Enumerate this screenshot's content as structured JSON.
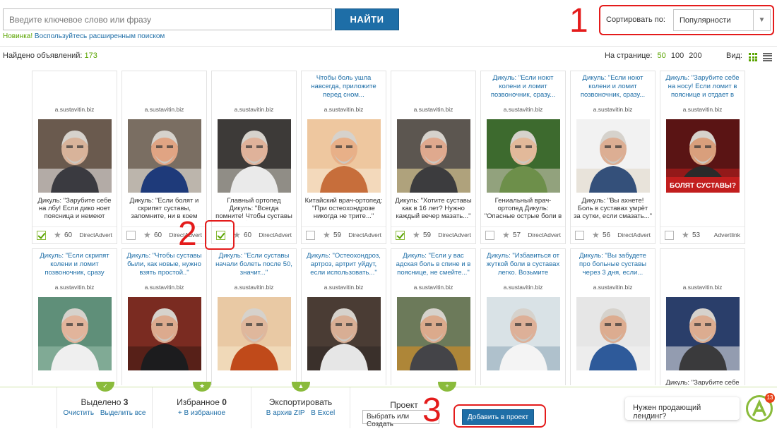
{
  "search": {
    "placeholder": "Введите ключевое слово или фразу",
    "button": "НАЙТИ",
    "hint_new": "Новинка!",
    "hint_link": "Воспользуйтесь расширенным поиском"
  },
  "sort": {
    "label": "Сортировать по:",
    "value": "Популярности"
  },
  "annotations": [
    "1",
    "2",
    "3"
  ],
  "results": {
    "found_label": "Найдено объявлений:",
    "found_count": "173",
    "per_page_label": "На странице:",
    "per_page_options": [
      "50",
      "100",
      "200"
    ],
    "per_page_active": "50",
    "view_label": "Вид:"
  },
  "cards": [
    {
      "title": "",
      "domain": "a.sustavitin.biz",
      "desc": "Дикуль: \"Зарубите себе на лбу! Если дико ноет поясница и немеют ноги...\"",
      "checked": true,
      "score": "60",
      "network": "DirectAdvert",
      "photo": "bearded-man-garlic"
    },
    {
      "title": "",
      "domain": "a.sustavitin.biz",
      "desc": "Дикуль: \"Если болят и скрипят суставы, запомните, ни в коем случае...\"",
      "checked": false,
      "score": "60",
      "network": "DirectAdvert",
      "photo": "strongman-lifting"
    },
    {
      "title": "",
      "domain": "a.sustavitin.biz",
      "desc": "Главный ортопед Дикуль: \"Всегда помните! Чтобы суставы не болели...\"",
      "checked": true,
      "score": "60",
      "network": "DirectAdvert",
      "photo": "man-at-table"
    },
    {
      "title": "Чтобы боль ушла навсегда, приложите перед сном...",
      "domain": "a.sustavitin.biz",
      "desc": "Китайский врач-ортопед: \"При остеохондрозе никогда не трите...\"",
      "checked": false,
      "score": "59",
      "network": "DirectAdvert",
      "photo": "neck-bagel"
    },
    {
      "title": "",
      "domain": "a.sustavitin.biz",
      "desc": "Дикуль: \"Хотите суставы как в 16 лет? Нужно каждый вечер мазать...\"",
      "checked": true,
      "score": "59",
      "network": "DirectAdvert",
      "photo": "man-with-soda"
    },
    {
      "title": "Дикуль: \"Если ноют колени и ломит позвоночник, сразу...",
      "domain": "a.sustavitin.biz",
      "desc": "Гениальный врач-ортопед Дикуль: \"Опасные острые боли в суставах полностью...\"",
      "checked": false,
      "score": "57",
      "network": "DirectAdvert",
      "photo": "woman-yoga"
    },
    {
      "title": "Дикуль: \"Если ноют колени и ломит позвоночник, сразу...",
      "domain": "a.sustavitin.biz",
      "desc": "Дикуль: \"Вы ахнете! Боль в суставах умрёт за сутки, если смазать...\"",
      "checked": false,
      "score": "56",
      "network": "DirectAdvert",
      "photo": "man-with-soda-2"
    },
    {
      "title": "Дикуль: \"Зарубите себе на носу! Если ломит в пояснице и отдает в",
      "domain": "a.sustavitin.biz",
      "desc": "",
      "checked": false,
      "score": "53",
      "network": "Advertlink",
      "photo": "strongman-banner",
      "photo_text": "БОЛЯТ СУСТАВЫ?"
    },
    {
      "title": "Дикуль: \"Если скрипят колени и ломит позвоночник, сразу",
      "domain": "a.sustavitin.biz",
      "desc": "",
      "checked": false,
      "score": "",
      "network": "",
      "photo": "man-white-coat"
    },
    {
      "title": "Дикуль: \"Чтобы суставы были, как новые, нужно взять простой..\"",
      "domain": "a.sustavitin.biz",
      "desc": "",
      "checked": false,
      "score": "",
      "network": "",
      "photo": "man-dark-suit"
    },
    {
      "title": "Дикуль: \"Если суставы начали болеть после 50, значит...\"",
      "domain": "a.sustavitin.biz",
      "desc": "",
      "checked": false,
      "score": "",
      "network": "",
      "photo": "man-spine"
    },
    {
      "title": "Дикуль: \"Остеохондроз, артроз, артрит уйдут, если использовать...\"",
      "domain": "a.sustavitin.biz",
      "desc": "",
      "checked": false,
      "score": "",
      "network": "",
      "photo": "man-thinking"
    },
    {
      "title": "Дикуль: \"Если у вас адская боль в спине и в пояснице, не смейте...\"",
      "domain": "a.sustavitin.biz",
      "desc": "",
      "checked": false,
      "score": "",
      "network": "",
      "photo": "man-microphone"
    },
    {
      "title": "Дикуль: \"Избавиться от жуткой боли в суставах легко. Возьмите",
      "domain": "a.sustavitin.biz",
      "desc": "",
      "checked": false,
      "score": "",
      "network": "",
      "photo": "man-lab-coat"
    },
    {
      "title": "Дикуль: \"Вы забудете про больные суставы через 3 дня, если...",
      "domain": "a.sustavitin.biz",
      "desc": "",
      "checked": false,
      "score": "",
      "network": "",
      "photo": "man-blue-scrubs"
    },
    {
      "title": "",
      "domain": "a.sustavitin.biz",
      "desc": "Дикуль: \"Зарубите себе на носу! Если...\"",
      "checked": false,
      "score": "",
      "network": "",
      "photo": "man-garlic-2"
    }
  ],
  "bottom": {
    "selected_label": "Выделено",
    "selected_count": "3",
    "clear": "Очистить",
    "select_all": "Выделить все",
    "fav_label": "Избранное",
    "fav_count": "0",
    "to_fav": "+ В избранное",
    "export_label": "Экспортировать",
    "zip": "В архив ZIP",
    "excel": "В Excel",
    "project_label": "Проект",
    "project_select": "Выбрать или Создать",
    "add_button": "Добавить в проект"
  },
  "chat": {
    "text": "Нужен продающий лендинг?",
    "badge": "13"
  },
  "colors": {
    "accent_blue": "#1e6ea7",
    "accent_green": "#5aa400",
    "annotation_red": "#e41b1b"
  }
}
